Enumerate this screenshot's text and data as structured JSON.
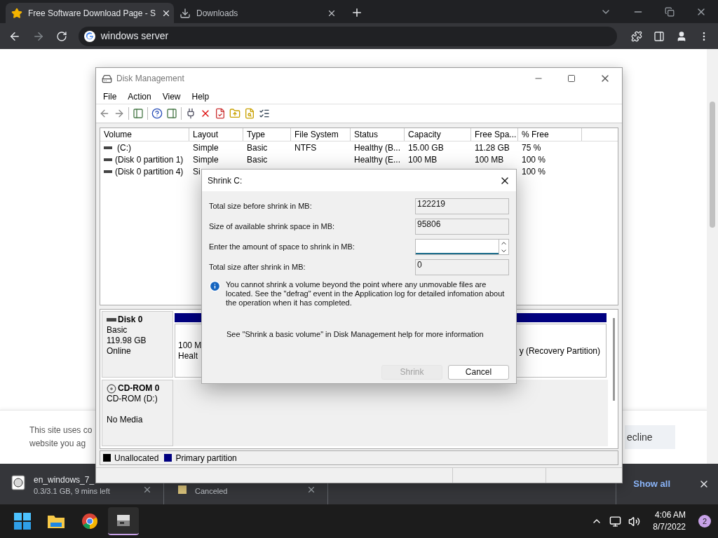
{
  "browser": {
    "tabs": [
      {
        "title": "Free Software Download Page - S",
        "selected": true
      },
      {
        "title": "Downloads",
        "selected": false
      }
    ],
    "address": "windows server"
  },
  "page": {
    "cookie_lines": [
      "This site uses co",
      "website you ag"
    ],
    "decline": "ecline"
  },
  "disk_management": {
    "title": "Disk Management",
    "menu": [
      "File",
      "Action",
      "View",
      "Help"
    ],
    "columns": [
      "Volume",
      "Layout",
      "Type",
      "File System",
      "Status",
      "Capacity",
      "Free Spa...",
      "% Free"
    ],
    "rows": [
      [
        "(C:)",
        "Simple",
        "Basic",
        "NTFS",
        "Healthy (B...",
        "15.00 GB",
        "11.28 GB",
        "75 %"
      ],
      [
        "(Disk 0 partition 1)",
        "Simple",
        "Basic",
        "",
        "Healthy (E...",
        "100 MB",
        "100 MB",
        "100 %"
      ],
      [
        "(Disk 0 partition 4)",
        "Si",
        "",
        "",
        "",
        "",
        "",
        "100 %"
      ]
    ],
    "disks": [
      {
        "kind": "disk",
        "name": "Disk 0",
        "lines": [
          "Basic",
          "119.98 GB",
          "Online"
        ],
        "left_partition": [
          "100 M",
          "Healt"
        ],
        "right_partition": "y (Recovery Partition)"
      },
      {
        "kind": "cdrom",
        "name": "CD-ROM 0",
        "lines": [
          "CD-ROM (D:)",
          "No Media"
        ]
      }
    ],
    "legend": [
      {
        "label": "Unallocated",
        "color": "#000000"
      },
      {
        "label": "Primary partition",
        "color": "#000080"
      }
    ]
  },
  "dialog": {
    "title": "Shrink C:",
    "fields": [
      {
        "label": "Total size before shrink in MB:",
        "kind": "readonly",
        "value": "122219"
      },
      {
        "label": "Size of available shrink space in MB:",
        "kind": "readonly",
        "value": "95806"
      },
      {
        "label": "Enter the amount of space to shrink in MB:",
        "kind": "spin"
      },
      {
        "label": "Total size after shrink in MB:",
        "kind": "readonly",
        "value": "0"
      }
    ],
    "info": "You cannot shrink a volume beyond the point where any unmovable files are located. See the \"defrag\" event in the Application log for detailed infomation about the operation when it has completed.",
    "help": "See \"Shrink a basic volume\" in Disk Management help for more information",
    "buttons": [
      {
        "label": "Shrink",
        "disabled": true
      },
      {
        "label": "Cancel",
        "disabled": false
      }
    ]
  },
  "downloads": {
    "items": [
      {
        "name": "en_windows_7_",
        "status": "0.3/3.1 GB, 9 mins left"
      },
      {
        "status": "Canceled"
      }
    ],
    "show_all": "Show all"
  },
  "taskbar": {
    "time": "4:06 AM",
    "date": "8/7/2022",
    "badge": "2"
  }
}
